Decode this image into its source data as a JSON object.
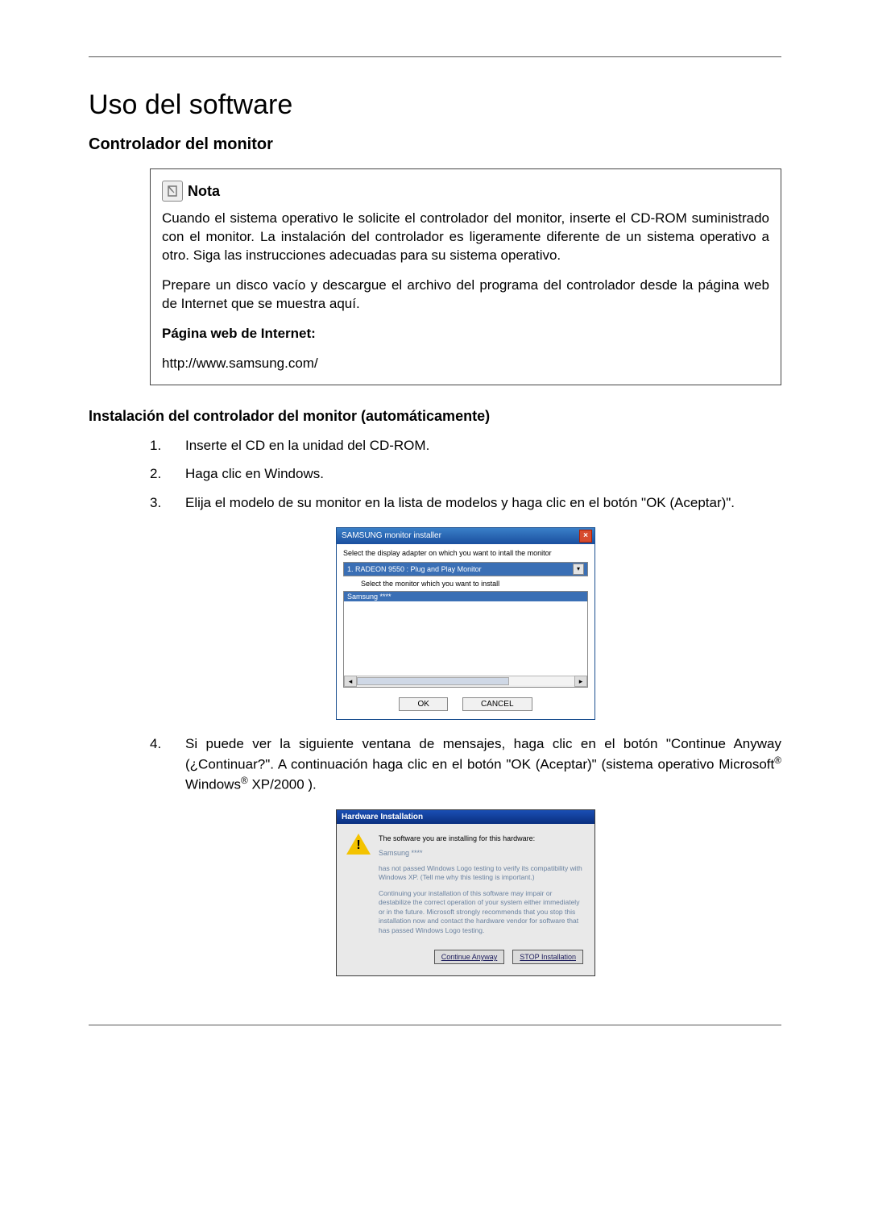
{
  "title": "Uso del software",
  "section1": "Controlador del monitor",
  "note": {
    "label": "Nota",
    "p1": "Cuando el sistema operativo le solicite el controlador del monitor, inserte el CD-ROM suministrado con el monitor. La instalación del controlador es ligeramente diferente de un sistema operativo a otro. Siga las instrucciones adecuadas para su sistema operativo.",
    "p2": "Prepare un disco vacío y descargue el archivo del programa del controlador desde la página web de Internet que se muestra aquí.",
    "p3_label": "Página web de Internet:",
    "url": "http://www.samsung.com/"
  },
  "section2": "Instalación del controlador del monitor (automáticamente)",
  "steps": {
    "s1_num": "1.",
    "s1": "Inserte el CD en la unidad del CD-ROM.",
    "s2_num": "2.",
    "s2": "Haga clic en Windows.",
    "s3_num": "3.",
    "s3": "Elija el modelo de su monitor en la lista de modelos y haga clic en el botón \"OK (Aceptar)\".",
    "s4_num": "4.",
    "s4_a": "Si puede ver la siguiente ventana de mensajes, haga clic en el botón \"Continue Anyway (¿Continuar?\". A continuación haga clic en el botón \"OK (Aceptar)\" (sistema operativo Microsoft",
    "s4_b": " Windows",
    "s4_c": " XP/2000 )."
  },
  "installer": {
    "title": "SAMSUNG monitor installer",
    "label1": "Select the display adapter on which you want to intall the monitor",
    "combo": "1. RADEON 9550 : Plug and Play Monitor",
    "label2": "Select the monitor which you want to install",
    "selected": "Samsung ****",
    "ok": "OK",
    "cancel": "CANCEL"
  },
  "warn": {
    "title": "Hardware Installation",
    "software_line": "The software you are installing for this hardware:",
    "samsung": "Samsung ****",
    "para1": "has not passed Windows Logo testing to verify its compatibility with Windows XP. (Tell me why this testing is important.)",
    "para2": "Continuing your installation of this software may impair or destabilize the correct operation of your system either immediately or in the future. Microsoft strongly recommends that you stop this installation now and contact the hardware vendor for software that has passed Windows Logo testing.",
    "btn_continue": "Continue Anyway",
    "btn_stop": "STOP Installation"
  }
}
